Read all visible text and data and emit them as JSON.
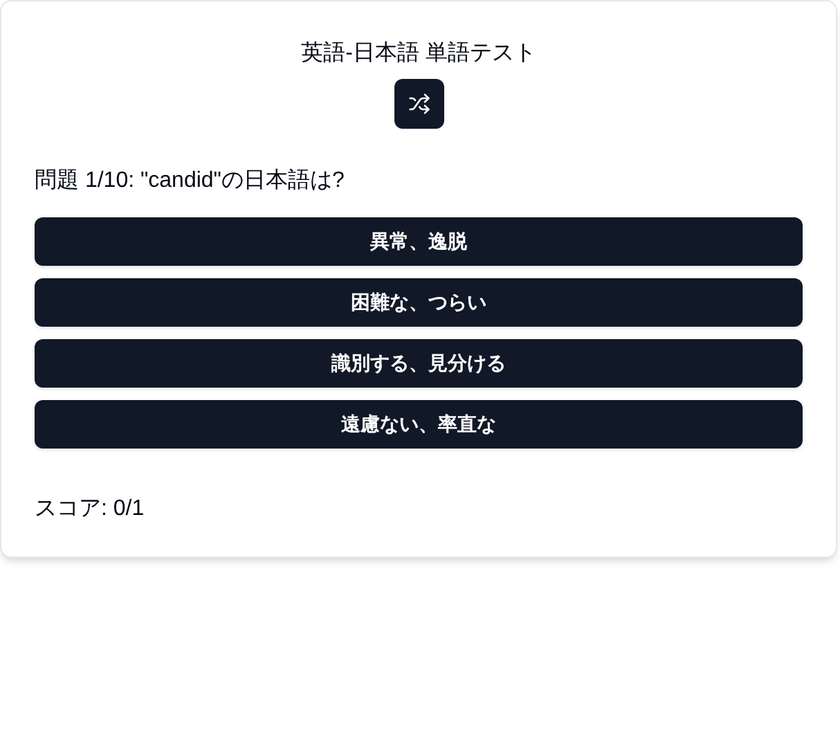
{
  "title": "英語-日本語 単語テスト",
  "question": "問題 1/10: \"candid\"の日本語は?",
  "options": [
    {
      "label": "異常、逸脱"
    },
    {
      "label": "困難な、つらい"
    },
    {
      "label": "識別する、見分ける"
    },
    {
      "label": "遠慮ない、率直な"
    }
  ],
  "score": "スコア: 0/1"
}
